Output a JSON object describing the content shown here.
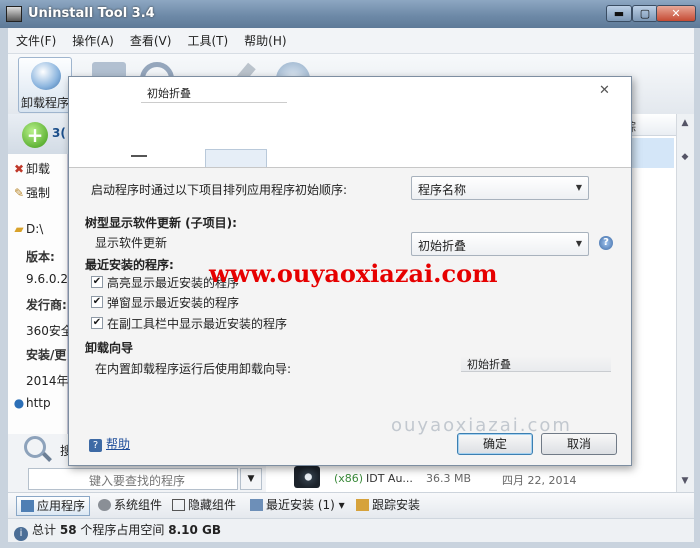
{
  "window": {
    "title": "Uninstall Tool 3.4",
    "controls": {
      "minimize": "▬",
      "maximize": "▢",
      "close": "✕"
    }
  },
  "menu": [
    "文件(F)",
    "操作(A)",
    "查看(V)",
    "工具(T)",
    "帮助(H)"
  ],
  "toolbar": {
    "uninstall_label": "卸载程序"
  },
  "left_panel": {
    "header_name": "3(",
    "uninstall_action": "卸载",
    "force_action": "强制",
    "path_prefix": "D:\\",
    "version_label": "版本:",
    "version_value": "9.6.0.2(",
    "publisher_label": "发行商:",
    "publisher_value": "360安全",
    "install_label": "安装/更",
    "install_value": "2014年",
    "website_value": "http"
  },
  "search": {
    "button_label": "搜",
    "placeholder": "键入要查找的程序"
  },
  "list": {
    "header_visible": "踪",
    "row": {
      "arch": "(x86)",
      "name": "IDT Au...",
      "size": "36.3 MB",
      "date": "四月 22, 2014"
    }
  },
  "bottom_tabs": [
    "应用程序",
    "系统组件",
    "隐藏组件",
    "最近安装 (1)",
    "跟踪安装"
  ],
  "status": {
    "prefix": "总计",
    "count": "58",
    "middle": "个程序占用空间",
    "size": "8.10 GB"
  },
  "dialog": {
    "close_label": "✕",
    "tab_fragment": "初始折叠",
    "startup_order_label": "启动程序时通过以下项目排列应用程序初始顺序:",
    "startup_order_value": "程序名称",
    "tree_update_heading": "树型显示软件更新 (子项目):",
    "show_updates_label": "显示软件更新",
    "show_updates_value": "初始折叠",
    "recent_heading": "最近安装的程序:",
    "checkboxes": [
      {
        "label": "高亮显示最近安装的程序",
        "checked": true
      },
      {
        "label": "弹窗显示最近安装的程序",
        "checked": true
      },
      {
        "label": "在副工具栏中显示最近安装的程序",
        "checked": true
      }
    ],
    "wizard_heading": "卸载向导",
    "wizard_label": "在内置卸载程序运行后使用卸载向导:",
    "wizard_value": "初始折叠",
    "help_label": "帮助",
    "ok_label": "确定",
    "cancel_label": "取消"
  },
  "watermark": "www.ouyaoxiazai.com",
  "faint_mark": "ouyaoxiazai.com",
  "colors": {
    "watermark": "#e60000",
    "selection": "#d4e6f8",
    "link": "#1f4e9a"
  }
}
